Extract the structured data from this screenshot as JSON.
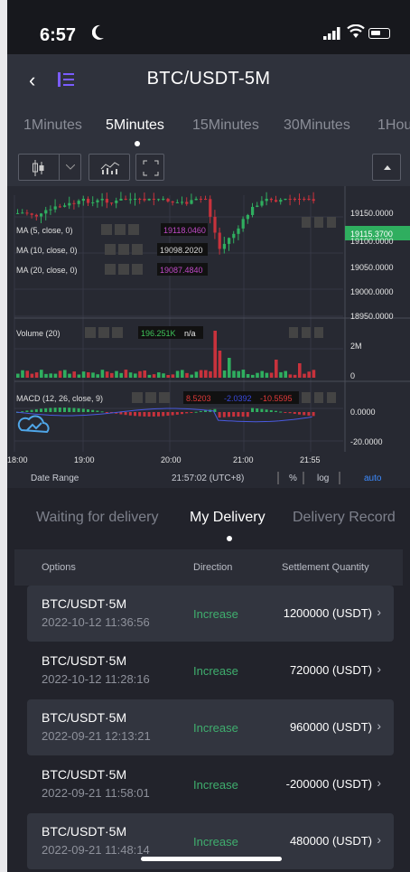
{
  "status": {
    "time": "6:57"
  },
  "nav": {
    "title": "BTC/USDT-5M"
  },
  "periods": [
    "1Minutes",
    "5Minutes",
    "15Minutes",
    "30Minutes",
    "1Hou"
  ],
  "chart": {
    "indicators": {
      "ma5_label": "MA (5, close, 0)",
      "ma5_value": "19118.0460",
      "ma10_label": "MA (10, close, 0)",
      "ma10_value": "19098.2020",
      "ma20_label": "MA (20, close, 0)",
      "ma20_value": "19087.4840",
      "volume_label": "Volume (20)",
      "volume_value": "196.251K",
      "volume_na": "n/a",
      "macd_label": "MACD (12, 26, close, 9)",
      "macd_v1": "8.5203",
      "macd_v2": "-2.0392",
      "macd_v3": "-10.5595"
    },
    "price_axis": [
      "19150.0000",
      "19115.3700",
      "19100.0000",
      "19050.0000",
      "19000.0000",
      "18950.0000"
    ],
    "volume_axis": [
      "2M",
      "0"
    ],
    "macd_axis": [
      "0.0000",
      "-20.0000"
    ],
    "time_axis": [
      "18:00",
      "19:00",
      "20:00",
      "21:00",
      "21:55"
    ],
    "footer": {
      "date_range": "Date Range",
      "timestamp": "21:57:02 (UTC+8)",
      "pct": "%",
      "log": "log",
      "auto": "auto"
    },
    "colors": {
      "up": "#2fae5f",
      "down": "#c8323c"
    }
  },
  "delivery_tabs": [
    "Waiting for delivery",
    "My Delivery",
    "Delivery Record"
  ],
  "list_header": {
    "options": "Options",
    "direction": "Direction",
    "settlement": "Settlement Quantity"
  },
  "rows": [
    {
      "pair": "BTC/USDT·5M",
      "datetime": "2022-10-12 11:36:56",
      "direction": "Increase",
      "quantity": "1200000 (USDT)"
    },
    {
      "pair": "BTC/USDT·5M",
      "datetime": "2022-10-12 11:28:16",
      "direction": "Increase",
      "quantity": "720000 (USDT)"
    },
    {
      "pair": "BTC/USDT·5M",
      "datetime": "2022-09-21 12:13:21",
      "direction": "Increase",
      "quantity": "960000 (USDT)"
    },
    {
      "pair": "BTC/USDT·5M",
      "datetime": "2022-09-21 11:58:01",
      "direction": "Increase",
      "quantity": "-200000 (USDT)"
    },
    {
      "pair": "BTC/USDT·5M",
      "datetime": "2022-09-21 11:48:14",
      "direction": "Increase",
      "quantity": "480000 (USDT)"
    }
  ]
}
